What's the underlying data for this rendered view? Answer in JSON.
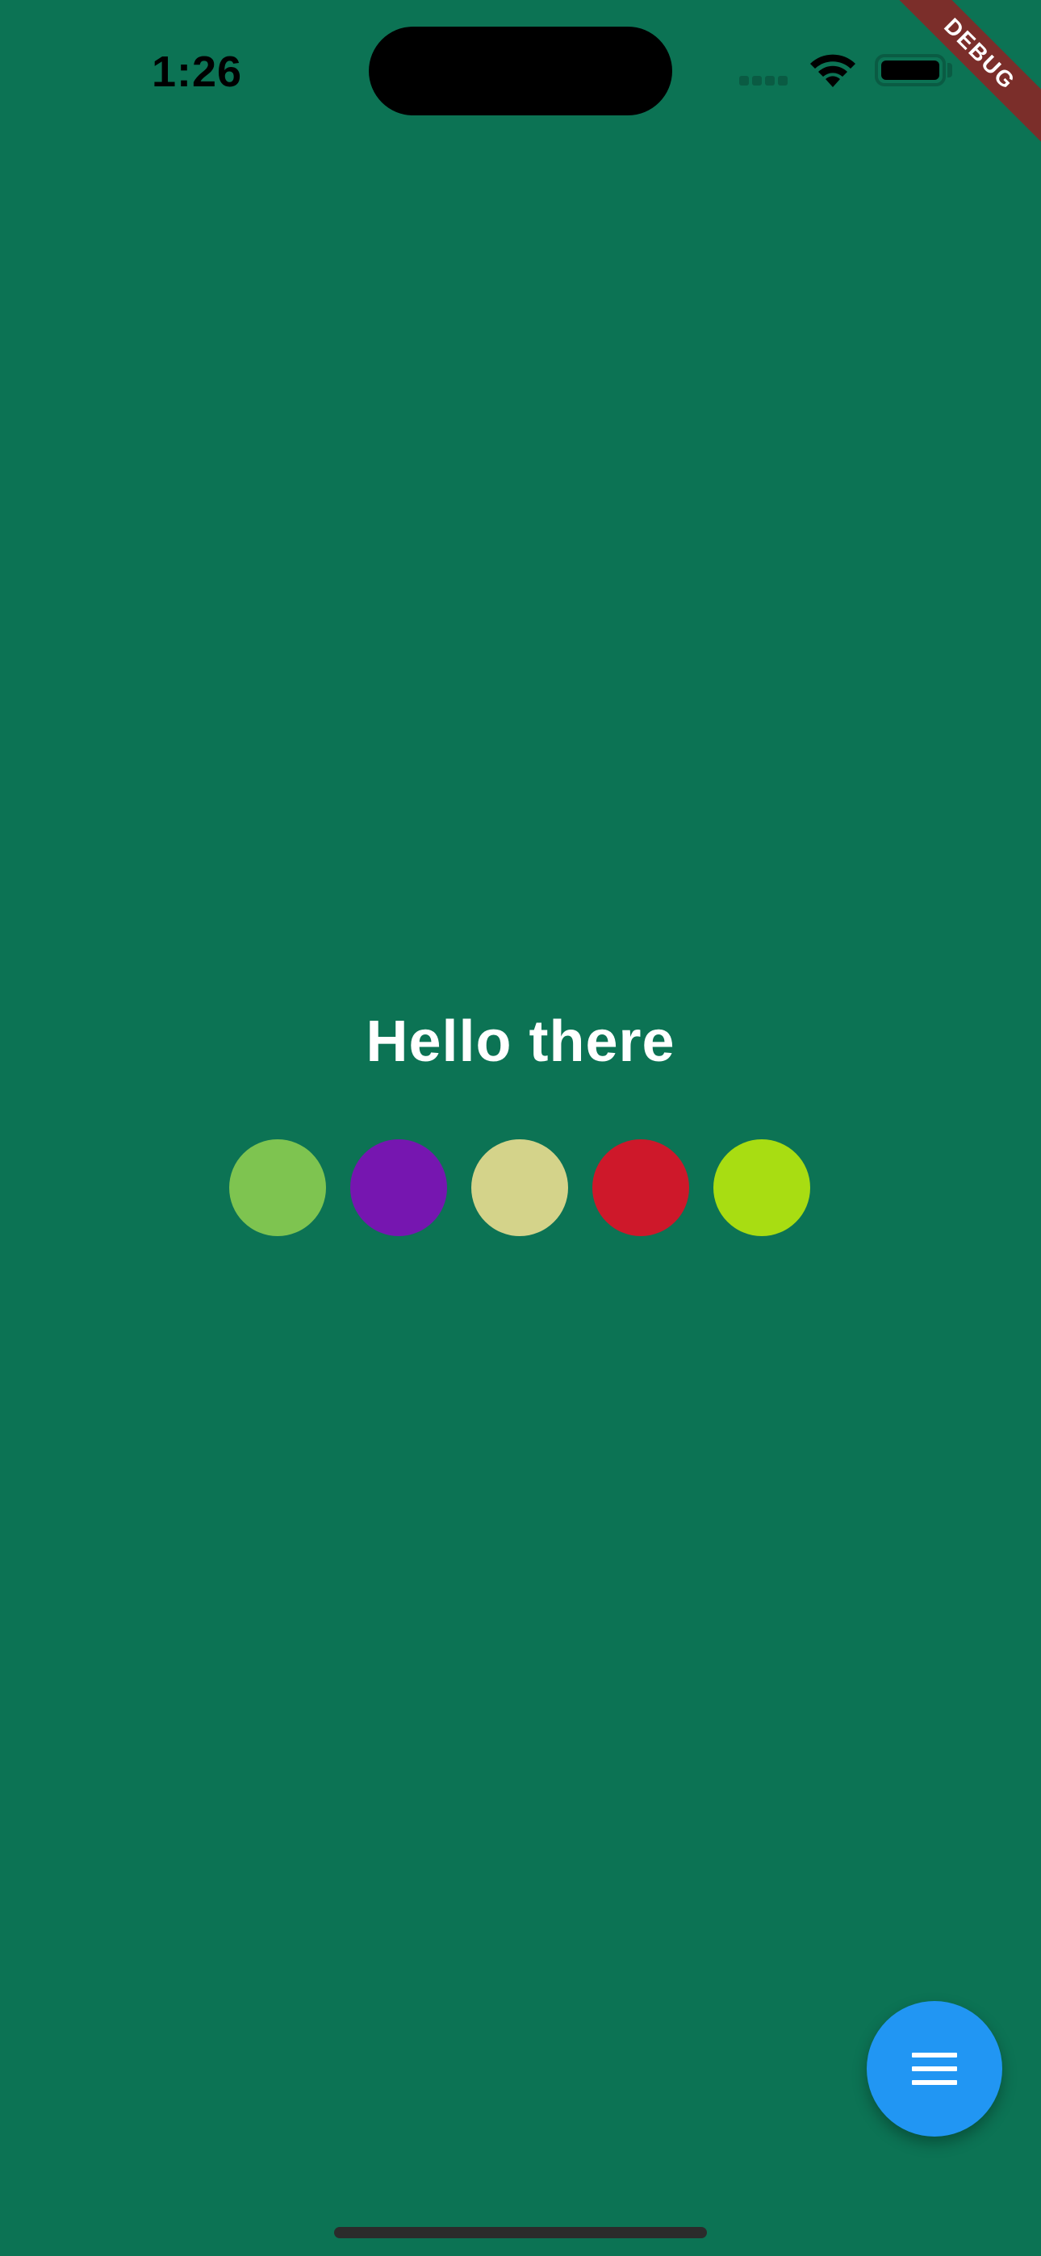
{
  "status_bar": {
    "time": "1:26",
    "signal_icon": "cellular-signal-icon",
    "wifi_icon": "wifi-icon",
    "battery_icon": "battery-icon"
  },
  "debug_banner": {
    "label": "DEBUG",
    "color": "#7B2E2A"
  },
  "main": {
    "title": "Hello there",
    "background_color": "#0C7354",
    "color_dots": [
      {
        "color": "#7EC450"
      },
      {
        "color": "#7616B0"
      },
      {
        "color": "#D4D38A"
      },
      {
        "color": "#CE182A"
      },
      {
        "color": "#A8DD12"
      }
    ]
  },
  "fab": {
    "icon": "menu-icon",
    "color": "#2196F3"
  }
}
